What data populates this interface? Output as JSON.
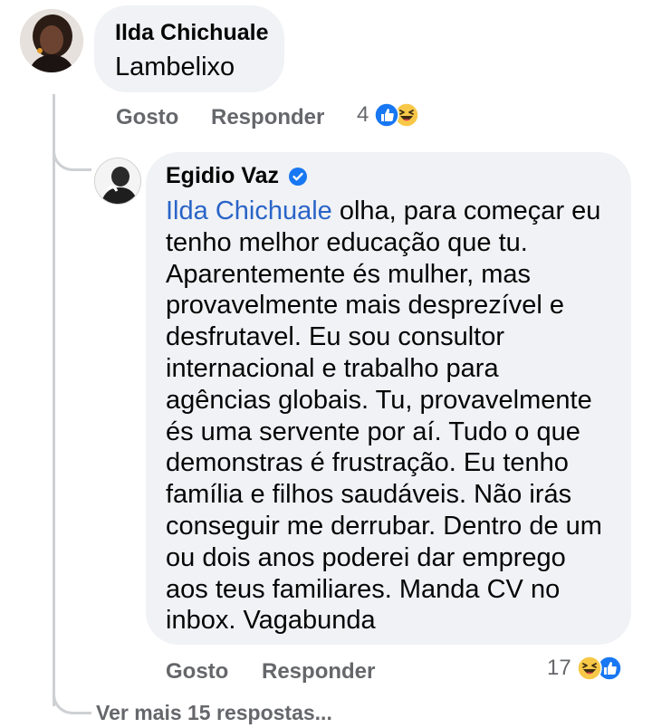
{
  "comment": {
    "author": "Ilda Chichuale",
    "text": "Lambelixo",
    "actions": {
      "like": "Gosto",
      "reply": "Responder"
    },
    "reaction_count": "4",
    "reactions": [
      "like-icon",
      "haha-icon"
    ]
  },
  "reply": {
    "author": "Egidio Vaz",
    "verified_badge": "verified-badge-icon",
    "mention": "Ilda Chichuale",
    "text_lines": [
      " olha, para começar eu",
      "tenho melhor educação que tu.",
      "Aparentemente és mulher, mas",
      "provavelmente mais desprezível e",
      "desfrutavel. Eu sou consultor",
      "internacional e trabalho para",
      "agências globais. Tu, provavelmente",
      "és uma servente por aí. Tudo o que",
      "demonstras é frustração. Eu tenho",
      "família e filhos saudáveis. Não irás",
      "conseguir me derrubar. Dentro de um",
      "ou dois anos poderei dar emprego",
      "aos teus familiares. Manda CV no",
      "inbox. Vagabunda"
    ],
    "actions": {
      "like": "Gosto",
      "reply": "Responder"
    },
    "reaction_count": "17",
    "reactions": [
      "haha-icon",
      "like-icon"
    ]
  },
  "more_replies": "Ver mais 15 respostas...",
  "colors": {
    "like_blue": "#1877f2",
    "mention": "#2a64c8",
    "muted": "#65676b",
    "bubble": "#f0f2f5",
    "haha_yellow": "#f7c847"
  }
}
